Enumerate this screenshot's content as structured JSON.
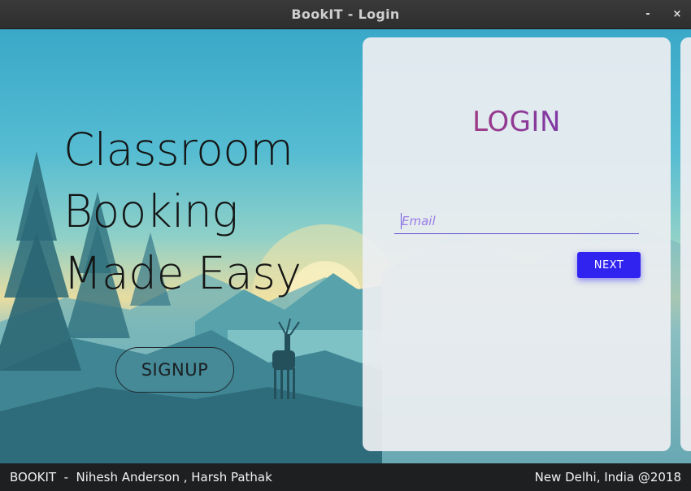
{
  "window": {
    "title": "BookIT - Login",
    "minimize_label": "-",
    "close_label": "×"
  },
  "hero": {
    "lines": [
      "Classroom",
      "Booking",
      "Made Easy"
    ],
    "signup_label": "SIGNUP"
  },
  "login": {
    "title": "LOGIN",
    "email_placeholder": "Email",
    "email_value": "",
    "next_label": "NEXT"
  },
  "footer": {
    "left_text": "BOOKIT  -  Nihesh Anderson , Harsh Pathak",
    "right_text": "New Delhi, India @2018"
  },
  "colors": {
    "accent": "#3123ef",
    "login_gradient_start": "#c2365a",
    "login_gradient_end": "#5b3bd0"
  }
}
